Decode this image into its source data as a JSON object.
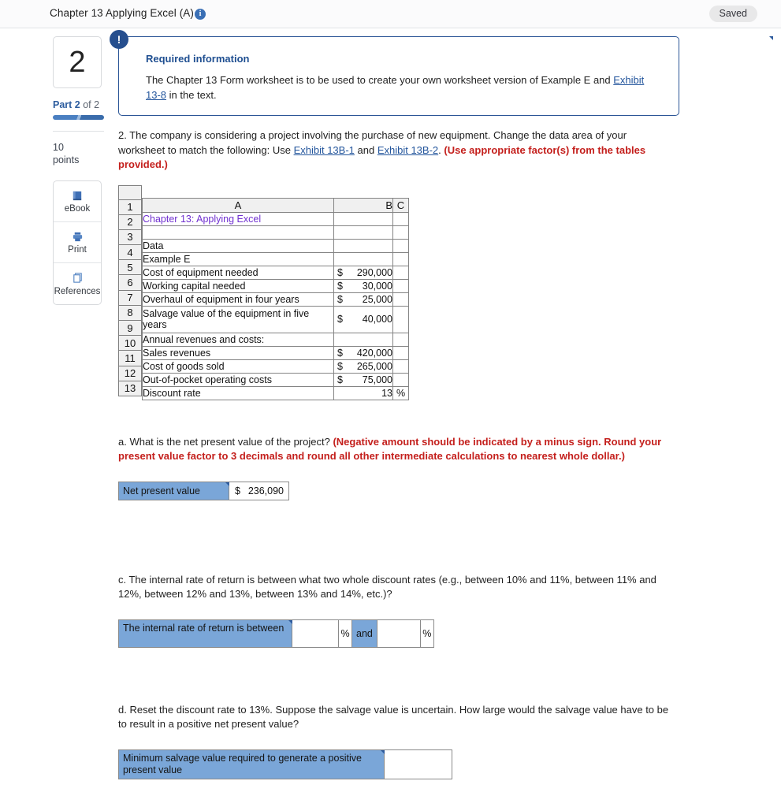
{
  "topbar": {
    "title": "Chapter 13 Applying Excel (A)",
    "info_icon": "info-icon",
    "saved_label": "Saved"
  },
  "sidebar": {
    "part_number": "2",
    "part_label_bold": "Part 2",
    "part_label_rest": " of 2",
    "points_value": "10",
    "points_word": "points",
    "tools": [
      {
        "label": "eBook",
        "icon": "book-icon"
      },
      {
        "label": "Print",
        "icon": "printer-icon"
      },
      {
        "label": "References",
        "icon": "copy-pages-icon"
      }
    ]
  },
  "callout": {
    "title": "Required information",
    "body_part1": "The Chapter 13 Form worksheet is to be used to create your own worksheet version of Example E and ",
    "link": "Exhibit 13-8",
    "body_part2": " in the text."
  },
  "question": {
    "intro_part1": "2. The company is considering a project involving the purchase of new equipment. Change the data area of your worksheet to match the following: Use ",
    "link1": "Exhibit 13B-1",
    "intro_mid": " and ",
    "link2": "Exhibit 13B-2",
    "intro_part2": ". ",
    "intro_red": "(Use appropriate factor(s) from the tables provided.)"
  },
  "spreadsheet": {
    "column_headers": [
      "",
      "A",
      "B",
      "C"
    ],
    "row_numbers": [
      "1",
      "2",
      "3",
      "4",
      "5",
      "6",
      "7",
      "8",
      "9",
      "10",
      "11",
      "12",
      "13"
    ],
    "rows": [
      {
        "a": "Chapter 13: Applying Excel",
        "b": "",
        "c": "",
        "style": "title"
      },
      {
        "a": "",
        "b": "",
        "c": "",
        "style": "plain"
      },
      {
        "a": "Data",
        "b": "",
        "c": "",
        "style": "bold"
      },
      {
        "a": "Example E",
        "b": "",
        "c": "",
        "style": "bold"
      },
      {
        "a": "Cost of equipment needed",
        "b": "290,000",
        "b_prefix": "$",
        "c": "",
        "style": "plain"
      },
      {
        "a": "Working capital needed",
        "b": "30,000",
        "b_prefix": "$",
        "c": "",
        "style": "plain"
      },
      {
        "a": "Overhaul of equipment in four years",
        "b": "25,000",
        "b_prefix": "$",
        "c": "",
        "style": "plain"
      },
      {
        "a": "Salvage value of the equipment in five years",
        "b": "40,000",
        "b_prefix": "$",
        "c": "",
        "style": "tall"
      },
      {
        "a": "Annual revenues and costs:",
        "b": "",
        "c": "",
        "style": "plain"
      },
      {
        "a": "Sales revenues",
        "b": "420,000",
        "b_prefix": "$",
        "c": "",
        "style": "indent"
      },
      {
        "a": "Cost of goods sold",
        "b": "265,000",
        "b_prefix": "$",
        "c": "",
        "style": "indent"
      },
      {
        "a": "Out-of-pocket operating costs",
        "b": "75,000",
        "b_prefix": "$",
        "c": "",
        "style": "indent"
      },
      {
        "a": "Discount rate",
        "b": "13",
        "b_prefix": "",
        "c": "%",
        "style": "plain"
      }
    ]
  },
  "part_a": {
    "text": "a. What is the net present value of the project? ",
    "text_red": "(Negative amount should be indicated by a minus sign. Round your present value factor to 3 decimals and round all other intermediate calculations to nearest whole dollar.)",
    "answer_label": "Net present value",
    "answer_prefix": "$",
    "answer_value": "236,090"
  },
  "part_c": {
    "text": "c. The internal rate of return is between what two whole discount rates (e.g., between 10% and 11%, between 11% and 12%, between 12% and 13%, between 13% and 14%, etc.)?",
    "answer_label": "The internal rate of return is between",
    "value_1": "",
    "percent_1": "%",
    "conjunction": "and",
    "value_2": "",
    "percent_2": "%"
  },
  "part_d": {
    "text": "d. Reset the discount rate to 13%. Suppose the salvage value is uncertain. How large would the salvage value have to be to result in a positive net present value?",
    "answer_label": "Minimum salvage value required to generate a positive present value",
    "value": ""
  },
  "colors": {
    "accent_blue": "#2c5c9e",
    "answer_label_blue": "#7aa6d8",
    "red_instruction": "#c4201d",
    "sheet_title_purple": "#7030d0"
  }
}
